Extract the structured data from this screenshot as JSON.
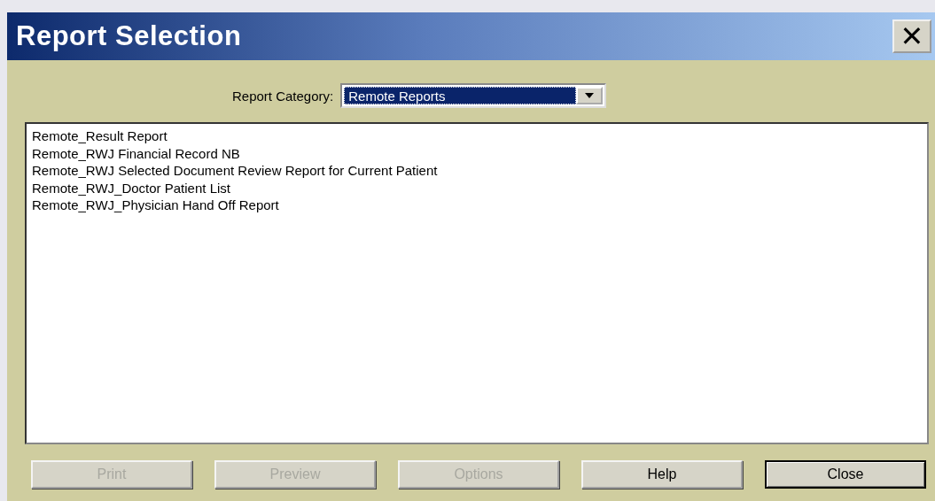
{
  "window": {
    "title": "Report Selection",
    "close_label": "✕"
  },
  "category": {
    "label": "Report Category:",
    "value": "Remote Reports"
  },
  "reports": [
    {
      "label": "Remote_Result Report",
      "selected": false
    },
    {
      "label": "Remote_RWJ Financial Record NB",
      "selected": false
    },
    {
      "label": "Remote_RWJ Selected Document Review Report for Current Patient",
      "selected": false
    },
    {
      "label": "Remote_RWJ_Doctor Patient List",
      "selected": false
    },
    {
      "label": "Remote_RWJ_Physician Hand Off Report",
      "selected": false
    }
  ],
  "buttons": [
    {
      "label": "Print",
      "disabled": true,
      "default": false
    },
    {
      "label": "Preview",
      "disabled": true,
      "default": false
    },
    {
      "label": "Options",
      "disabled": true,
      "default": false
    },
    {
      "label": "Help",
      "disabled": false,
      "default": false
    },
    {
      "label": "Close",
      "disabled": false,
      "default": true
    }
  ]
}
